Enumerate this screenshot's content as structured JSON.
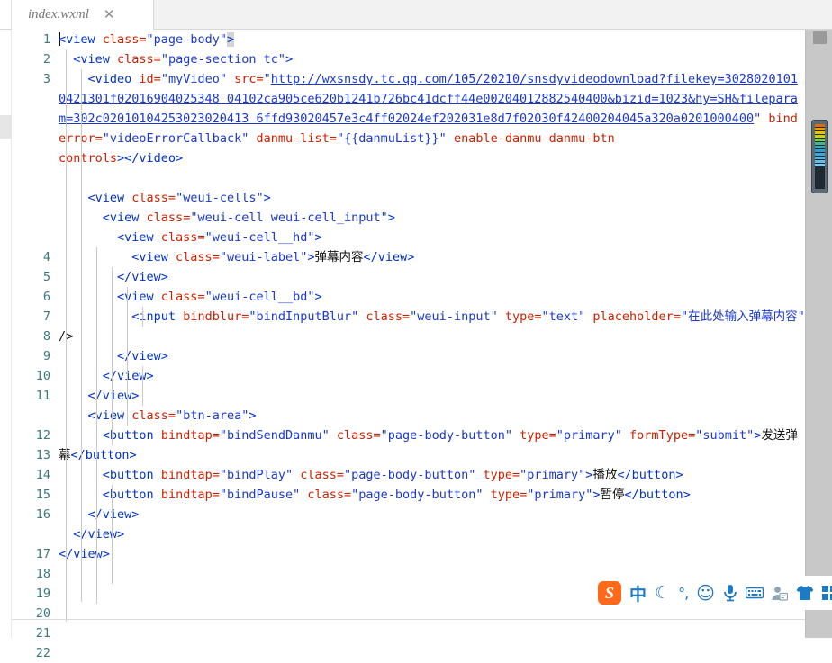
{
  "window": {
    "tab": {
      "title": "index.wxml",
      "close_label": "✕"
    }
  },
  "editor": {
    "language": "wxml",
    "line_numbers": [
      "1",
      "2",
      "3",
      "4",
      "5",
      "6",
      "7",
      "8",
      "9",
      "10",
      "11",
      "12",
      "13",
      "14",
      "15",
      "16",
      "17",
      "18",
      "19",
      "20",
      "21",
      "22"
    ],
    "colors": {
      "tag": "#0033cc",
      "attribute": "#cc2200",
      "string": "#1a39cc",
      "text": "#111111",
      "line_number": "#3b7a80",
      "background": "#ffffff"
    },
    "lines": {
      "l1_tag": "<view",
      "l1_attr": " class=",
      "l1_val": "\"page-body\"",
      "l1_close": ">",
      "l2_tag": "<view",
      "l2_attr": " class=",
      "l2_val": "\"page-section tc\"",
      "l2_close": ">",
      "l3_tag": "<video",
      "l3_attr_id": " id=",
      "l3_val_id": "\"myVideo\"",
      "l3_attr_src": " src=",
      "l3_quote_open": "\"",
      "l3_url_1": "http://wxsnsdy.tc.qq.com/105/20210/snsdyvideodownload?",
      "l3_url_2": "filekey=30280201010421301f02016904025348041 02ca905ce620b1241b726bc41dcff44e00204012882540400&",
      "l3_url_2_exact": "filekey=30280201010421301f02016904025348 04102ca905ce620b1241b726bc41dcff44e00204012882540400&",
      "l3_url_3": "bizid=1023&hy=SH&",
      "l3_url_4": "fileparam=302c02010104253023020413 6ffd93020457e3c4ff02024ef202031e8d7f02030f42400204045a320a0201000400",
      "l3_quote_close": "\"",
      "l3_attr_binderror": " binderror=",
      "l3_val_binderror": "\"videoErrorCallback\"",
      "l3_attr_danmulist": " danmu-list=",
      "l3_val_danmulist": "\"{{danmuList}}\"",
      "l3_attr_enable": "enable-danmu",
      "l3_attr_btn": "danmu-btn",
      "l3_attr_controls": "controls",
      "l3_tag_close": "></video>",
      "l5_tag": "<view",
      "l5_attr": " class=",
      "l5_val": "\"weui-cells\"",
      "l5_close": ">",
      "l6_tag": "<view",
      "l6_attr": " class=",
      "l6_val": "\"weui-cell weui-cell_input\"",
      "l6_close": ">",
      "l7_tag": "<view",
      "l7_attr": " class=",
      "l7_val": "\"weui-cell__hd\"",
      "l7_close": ">",
      "l8_tag": "<view",
      "l8_attr": " class=",
      "l8_val": "\"weui-label\"",
      "l8_close": ">",
      "l8_text": "弹幕内容",
      "l8_endtag": "</view>",
      "l9_endtag": "</view>",
      "l10_tag": "<view",
      "l10_attr": " class=",
      "l10_val": "\"weui-cell__bd\"",
      "l10_close": ">",
      "l11_tag": "<input",
      "l11_attr_bindblur": " bindblur=",
      "l11_val_bindblur": "\"bindInputBlur\"",
      "l11_attr_class": " class=",
      "l11_val_class": "\"weui-input\"",
      "l11_attr_type": " type=",
      "l11_val_type": "\"text\"",
      "l11_attr_ph": " placeholder=",
      "l11_val_ph": "\"在此处输入弹幕内容\"",
      "l11_selfclose": " />",
      "l12_endtag": "</view>",
      "l13_endtag": "</view>",
      "l14_endtag": "</view>",
      "l15_tag": "<view",
      "l15_attr": " class=",
      "l15_val": "\"btn-area\"",
      "l15_close": ">",
      "l16_tag": "<button",
      "l16_attr_bindtap": " bindtap=",
      "l16_val_bindtap": "\"bindSendDanmu\"",
      "l16_attr_class": " class=",
      "l16_val_class": "\"page-body-button\"",
      "l16_attr_type": " type=",
      "l16_val_type": "\"primary\"",
      "l16_attr_formtype": " formType=",
      "l16_val_formtype": "\"submit\"",
      "l16_close": ">",
      "l16_text": "发送弹幕",
      "l16_endtag": "</button>",
      "l17_tag": "<button",
      "l17_attr_bindtap": " bindtap=",
      "l17_val_bindtap": "\"bindPlay\"",
      "l17_attr_class": " class=",
      "l17_val_class": "\"page-body-button\"",
      "l17_attr_type": " type=",
      "l17_val_type": "\"primary\"",
      "l17_close": ">",
      "l17_text": "播放",
      "l17_endtag": "</button>",
      "l18_tag": "<button",
      "l18_attr_bindtap": " bindtap=",
      "l18_val_bindtap": "\"bindPause\"",
      "l18_attr_class": " class=",
      "l18_val_class": "\"page-body-button\"",
      "l18_attr_type": " type=",
      "l18_val_type": "\"primary\"",
      "l18_close": ">",
      "l18_text": "暂停",
      "l18_endtag": "</button>",
      "l19_endtag": "</view>",
      "l20_endtag": "</view>",
      "l21_endtag": "</view>"
    }
  },
  "ime_toolbar": {
    "name": "sogou-input-method",
    "items": [
      {
        "icon": "sogou-logo-icon",
        "label": "S"
      },
      {
        "icon": "chinese-mode-icon",
        "label": "中"
      },
      {
        "icon": "moon-icon",
        "label": "☾"
      },
      {
        "icon": "punctuation-icon",
        "label": "°,"
      },
      {
        "icon": "emoji-icon",
        "label": "☺"
      },
      {
        "icon": "microphone-icon",
        "label": "🎙"
      },
      {
        "icon": "keyboard-icon",
        "label": "⌨"
      },
      {
        "icon": "user-account-icon",
        "label": "👤"
      },
      {
        "icon": "skin-shirt-icon",
        "label": "👕"
      },
      {
        "icon": "toolbox-grid-icon",
        "label": ""
      }
    ]
  }
}
